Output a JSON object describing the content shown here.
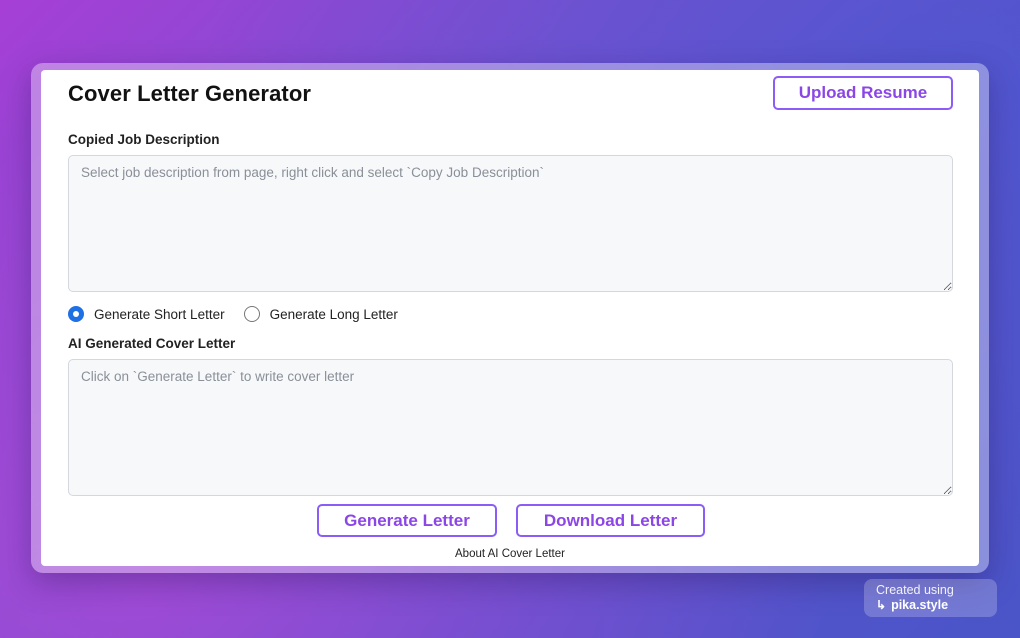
{
  "app": {
    "title": "Cover Letter Generator",
    "upload_label": "Upload Resume"
  },
  "job_description": {
    "label": "Copied Job Description",
    "value": "",
    "placeholder": "Select job description from page, right click and select `Copy Job Description`"
  },
  "length_options": [
    {
      "label": "Generate Short Letter",
      "selected": true
    },
    {
      "label": "Generate Long Letter",
      "selected": false
    }
  ],
  "generated_letter": {
    "label": "AI Generated Cover Letter",
    "value": "",
    "placeholder": "Click on `Generate Letter` to write cover letter"
  },
  "actions": {
    "generate_label": "Generate Letter",
    "download_label": "Download Letter"
  },
  "footer": {
    "about_label": "About AI Cover Letter"
  },
  "watermark": {
    "line1": "Created using",
    "line2": "pika.style",
    "icon": "return-arrow-icon"
  },
  "colors": {
    "accent": "#8b5cf6",
    "radio_selected": "#1f6fe5"
  }
}
